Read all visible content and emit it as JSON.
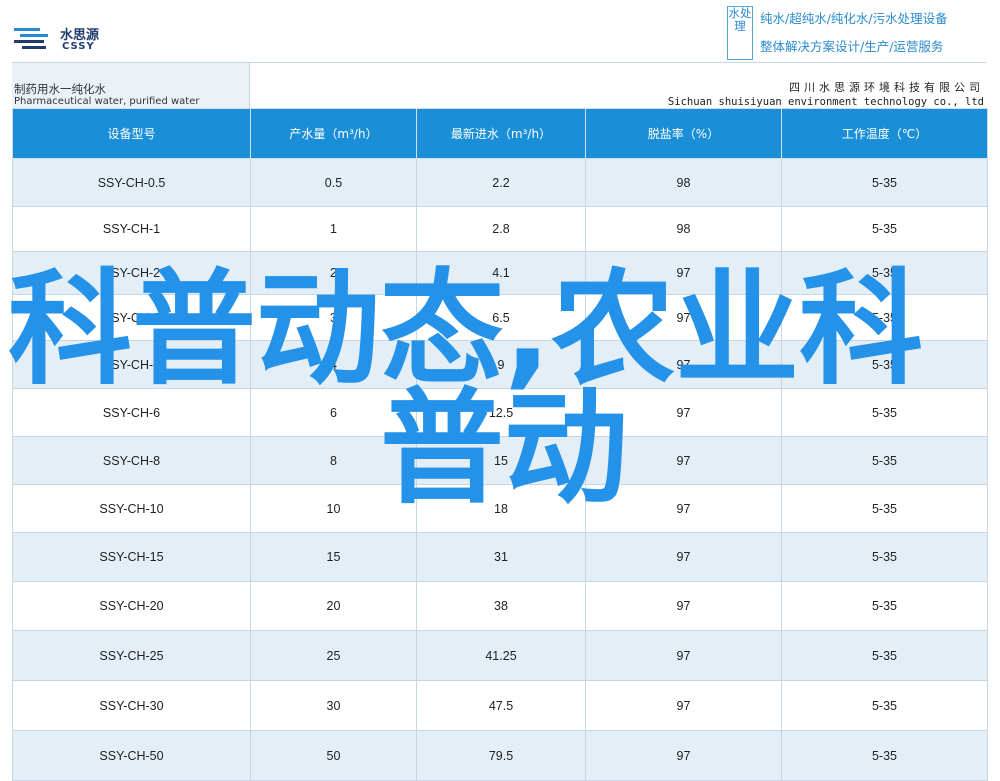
{
  "brand": {
    "name_cn": "水思源",
    "name_en": "CSSY"
  },
  "tagline": {
    "box_text": "水处理",
    "line1": "纯水/超纯水/纯化水/污水处理设备",
    "line2": "整体解决方案设计/生产/运营服务"
  },
  "header": {
    "product_cn": "制药用水一纯化水",
    "product_en": "Pharmaceutical water, purified water",
    "company_cn": "四川水思源环境科技有限公司",
    "company_en": "Sichuan shuisiyuan environment technology co., ltd"
  },
  "table": {
    "columns": [
      "设备型号",
      "产水量（m³/h）",
      "最新进水（m³/h）",
      "脱盐率（%）",
      "工作温度（℃）"
    ],
    "rows": [
      [
        "SSY-CH-0.5",
        "0.5",
        "2.2",
        "98",
        "5-35"
      ],
      [
        "SSY-CH-1",
        "1",
        "2.8",
        "98",
        "5-35"
      ],
      [
        "SSY-CH-2",
        "2",
        "4.1",
        "97",
        "5-35"
      ],
      [
        "SSY-CH-3",
        "3",
        "6.5",
        "97",
        "5-35"
      ],
      [
        "SSY-CH-4",
        "4",
        "9",
        "97",
        "5-35"
      ],
      [
        "SSY-CH-6",
        "6",
        "12.5",
        "97",
        "5-35"
      ],
      [
        "SSY-CH-8",
        "8",
        "15",
        "97",
        "5-35"
      ],
      [
        "SSY-CH-10",
        "10",
        "18",
        "97",
        "5-35"
      ],
      [
        "SSY-CH-15",
        "15",
        "31",
        "97",
        "5-35"
      ],
      [
        "SSY-CH-20",
        "20",
        "38",
        "97",
        "5-35"
      ],
      [
        "SSY-CH-25",
        "25",
        "41.25",
        "97",
        "5-35"
      ],
      [
        "SSY-CH-30",
        "30",
        "47.5",
        "97",
        "5-35"
      ],
      [
        "SSY-CH-50",
        "50",
        "79.5",
        "97",
        "5-35"
      ]
    ]
  },
  "overlay": {
    "line1": "科普动态,农业科",
    "line2": "普动"
  },
  "colors": {
    "accent": "#1a8fd8",
    "overlay": "#2492e8",
    "row_shade": "#e3eef7"
  }
}
